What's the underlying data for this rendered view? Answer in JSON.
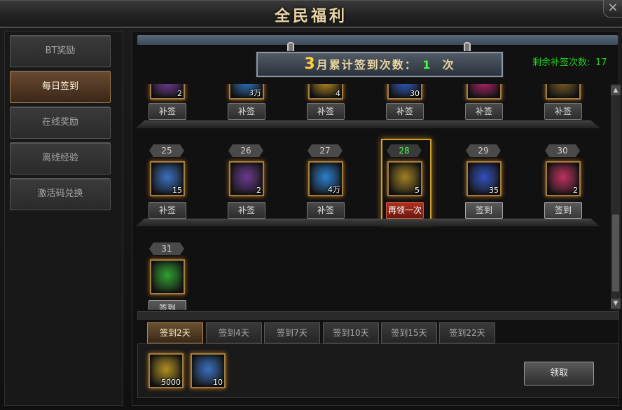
{
  "window": {
    "title": "全民福利",
    "close": "×"
  },
  "sidebar": {
    "items": [
      {
        "label": "BT奖励",
        "active": false
      },
      {
        "label": "每日签到",
        "active": true
      },
      {
        "label": "在线奖励",
        "active": false
      },
      {
        "label": "离线经验",
        "active": false
      },
      {
        "label": "激活码兑换",
        "active": false
      }
    ]
  },
  "banner": {
    "month": "3",
    "text": "月累计签到次数：",
    "count": "1",
    "unit": "次"
  },
  "remain": {
    "label": "剩余补签次数:",
    "value": "17"
  },
  "rows": {
    "row1": [
      {
        "qty": "2",
        "btn": "补签",
        "color": "#7a3aa0"
      },
      {
        "qty": "3万",
        "btn": "补签",
        "color": "#2a7ad0"
      },
      {
        "qty": "4",
        "btn": "补签",
        "color": "#c09020"
      },
      {
        "qty": "30",
        "btn": "补签",
        "color": "#3060d0"
      },
      {
        "qty": "",
        "btn": "补签",
        "color": "#c02070"
      },
      {
        "qty": "",
        "btn": "补签",
        "color": "#806020"
      }
    ],
    "row2": [
      {
        "day": "25",
        "qty": "15",
        "btn": "补签",
        "style": "",
        "color": "#3a70c0"
      },
      {
        "day": "26",
        "qty": "2",
        "btn": "补签",
        "style": "",
        "color": "#6a3a90"
      },
      {
        "day": "27",
        "qty": "4万",
        "btn": "补签",
        "style": "",
        "color": "#2a80d0"
      },
      {
        "day": "28",
        "qty": "5",
        "btn": "再领一次",
        "style": "red",
        "color": "#a08020"
      },
      {
        "day": "29",
        "qty": "35",
        "btn": "签到",
        "style": "light",
        "color": "#3050c0"
      },
      {
        "day": "30",
        "qty": "2",
        "btn": "签到",
        "style": "light",
        "color": "#c03060"
      }
    ],
    "row3": [
      {
        "day": "31",
        "qty": "",
        "btn": "签到",
        "style": "light",
        "color": "#30a030"
      }
    ]
  },
  "tabs": [
    {
      "label": "签到2天",
      "active": true
    },
    {
      "label": "签到4天",
      "active": false
    },
    {
      "label": "签到7天",
      "active": false
    },
    {
      "label": "签到10天",
      "active": false
    },
    {
      "label": "签到15天",
      "active": false
    },
    {
      "label": "签到22天",
      "active": false
    }
  ],
  "rewards": [
    {
      "qty": "5000",
      "color": "#b09020"
    },
    {
      "qty": "10",
      "color": "#3a70c0"
    }
  ],
  "claim": {
    "label": "领取"
  },
  "scroll": {
    "up": "▲",
    "down": "▼"
  }
}
